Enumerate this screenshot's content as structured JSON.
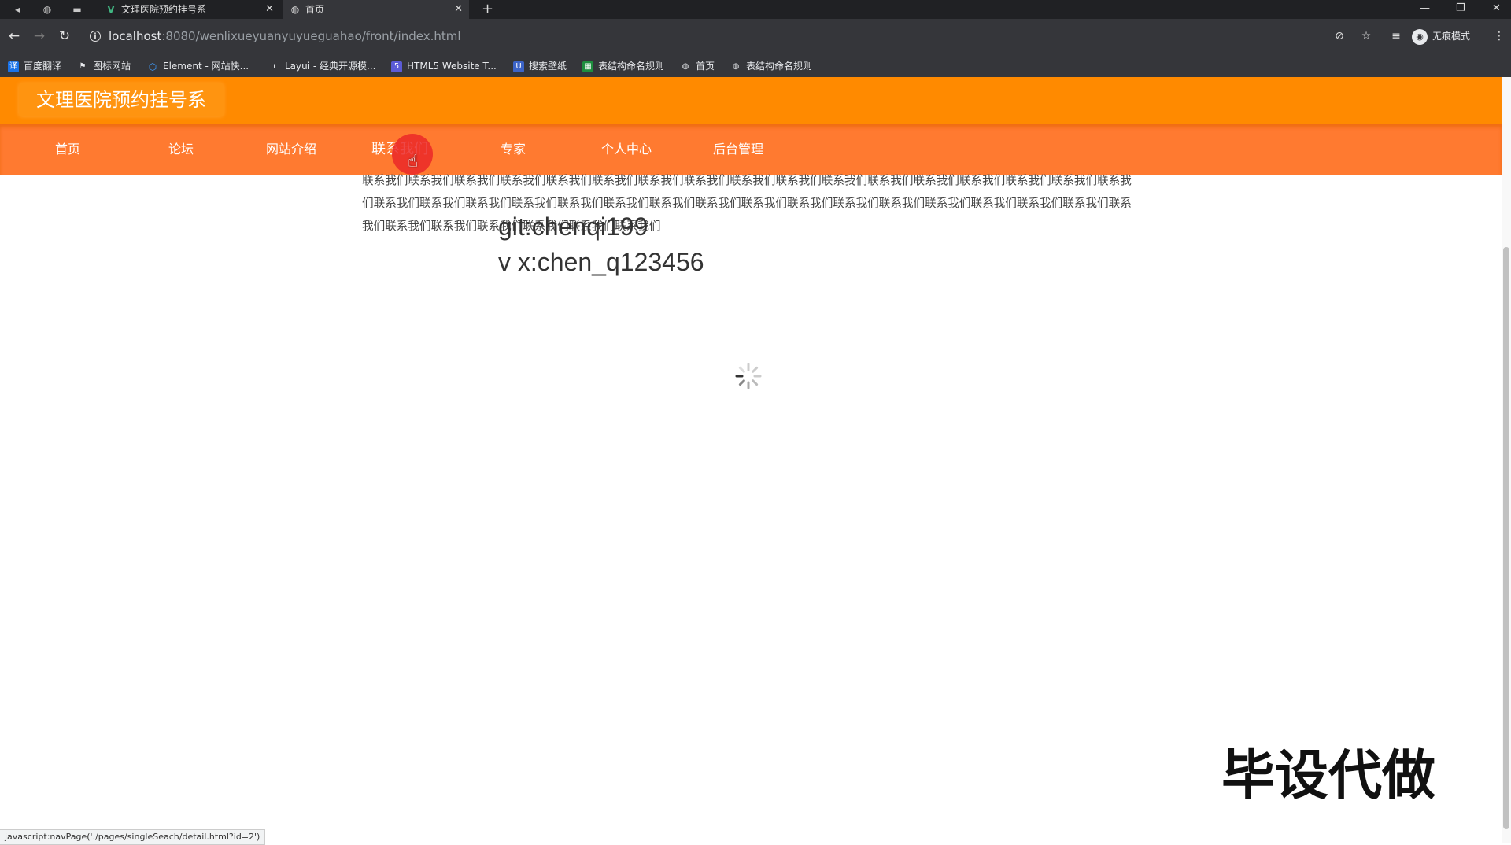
{
  "browser": {
    "tabs": [
      {
        "title": "文理医院预约挂号系",
        "active": false
      },
      {
        "title": "首页",
        "active": true
      }
    ],
    "new_tab": "+",
    "url_host": "localhost",
    "url_rest": ":8080/wenlixueyuanyuyueguahao/front/index.html",
    "profile_label": "无痕模式",
    "bookmarks": [
      {
        "label": "百度翻译",
        "icon": "translate-icon",
        "color": "#1a73e8"
      },
      {
        "label": "图标网站",
        "icon": "flag-icon",
        "color": "#202124"
      },
      {
        "label": "Element - 网站快...",
        "icon": "element-icon",
        "color": "#409eff"
      },
      {
        "label": "Layui - 经典开源模...",
        "icon": "layui-icon",
        "color": "#444"
      },
      {
        "label": "HTML5 Website T...",
        "icon": "html5-icon",
        "color": "#5b5bd6"
      },
      {
        "label": "搜索壁纸",
        "icon": "wallpaper-icon",
        "color": "#3c64c8"
      },
      {
        "label": "表结构命名规则",
        "icon": "sheet-icon",
        "color": "#1e8e3e"
      },
      {
        "label": "首页",
        "icon": "globe-icon",
        "color": "#555"
      },
      {
        "label": "表结构命名规则",
        "icon": "globe-icon",
        "color": "#555"
      }
    ],
    "status_url": "javascript:navPage('./pages/singleSeach/detail.html?id=2')"
  },
  "site": {
    "title": "文理医院预约挂号系",
    "nav": [
      "首页",
      "论坛",
      "网站介绍",
      "联系我们",
      "专家",
      "个人中心",
      "后台管理"
    ],
    "contact_text": "联系我们联系我们联系我们联系我们联系我们联系我们联系我们联系我们联系我们联系我们联系我们联系我们联系我们联系我们联系我们联系我们联系我们联系我们联系我们联系我们联系我们联系我们联系我们联系我们联系我们联系我们联系我们联系我们联系我们联系我们联系我们联系我们联系我们联系我们联系我们联系我们联系我们联系我们联系我们联系我们",
    "git": "git:chenqi199",
    "vx": "v x:chen_q123456"
  },
  "overlay": {
    "watermark": "毕设代做"
  },
  "colors": {
    "header": "#ff8a00",
    "navbar": "#ff7a30",
    "cursor_highlight": "#eb2828"
  }
}
